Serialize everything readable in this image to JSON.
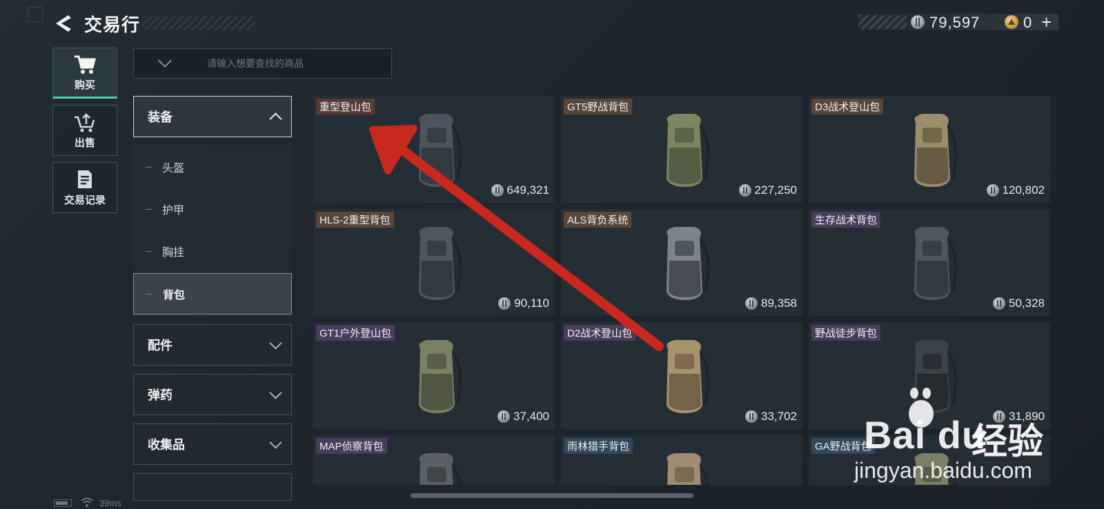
{
  "header": {
    "title": "交易行",
    "silver_amount": "79,597",
    "gold_amount": "0",
    "gold_plus": "+"
  },
  "nav": {
    "buy": "购买",
    "sell": "出售",
    "history": "交易记录"
  },
  "search": {
    "placeholder": "请输入想要查找的商品"
  },
  "categories": {
    "equipment": "装备",
    "sub_items": [
      "头盔",
      "护甲",
      "胸挂",
      "背包"
    ],
    "selected_sub": "背包",
    "parts": "配件",
    "ammo": "弹药",
    "collectibles": "收集品"
  },
  "items": [
    {
      "name": "重型登山包",
      "price": "649,321",
      "tag_color": "#5a3a37"
    },
    {
      "name": "GT5野战背包",
      "price": "227,250",
      "tag_color": "#5a4537"
    },
    {
      "name": "D3战术登山包",
      "price": "120,802",
      "tag_color": "#5a4537"
    },
    {
      "name": "HLS-2重型背包",
      "price": "90,110",
      "tag_color": "#5a4537"
    },
    {
      "name": "ALS背负系统",
      "price": "89,358",
      "tag_color": "#5a4537"
    },
    {
      "name": "生存战术背包",
      "price": "50,328",
      "tag_color": "#4a3d5c"
    },
    {
      "name": "GT1户外登山包",
      "price": "37,400",
      "tag_color": "#4a3d5c"
    },
    {
      "name": "D2战术登山包",
      "price": "33,702",
      "tag_color": "#4a3d5c"
    },
    {
      "name": "野战徒步背包",
      "price": "31,890",
      "tag_color": "#4a3d5c"
    },
    {
      "name": "MAP侦察背包",
      "price": "",
      "tag_color": "#4a3d5c"
    },
    {
      "name": "雨林猎手背包",
      "price": "",
      "tag_color": "#34485a"
    },
    {
      "name": "GA野战背包",
      "price": "",
      "tag_color": "#34485a"
    }
  ],
  "status": {
    "ping": "39ms"
  },
  "watermark": {
    "brand": "Bai du",
    "suffix": "经验",
    "url": "jingyan.baidu.com"
  },
  "colors": {
    "accent": "#4fd1b3",
    "arrow": "#c8281e"
  }
}
